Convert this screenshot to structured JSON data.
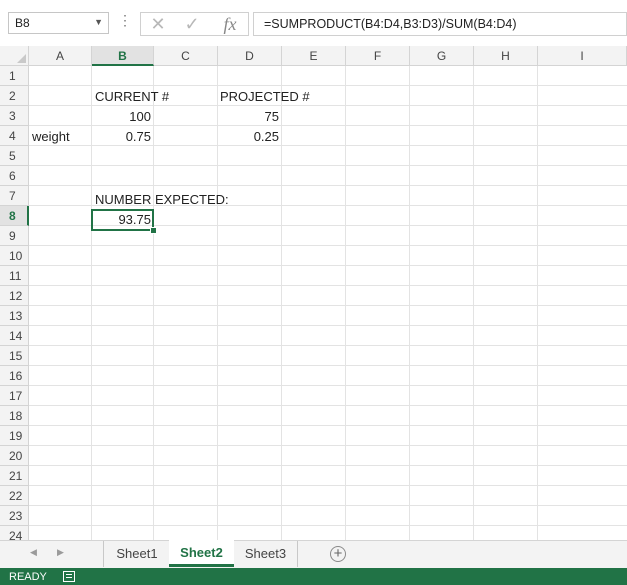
{
  "name_box": "B8",
  "formula": "=SUMPRODUCT(B4:D4,B3:D3)/SUM(B4:D4)",
  "columns": [
    "A",
    "B",
    "C",
    "D",
    "E",
    "F",
    "G",
    "H",
    "I"
  ],
  "rows": [
    "1",
    "2",
    "3",
    "4",
    "5",
    "6",
    "7",
    "8",
    "9",
    "10",
    "11",
    "12",
    "13",
    "14",
    "15",
    "16",
    "17",
    "18",
    "19",
    "20",
    "21",
    "22",
    "23",
    "24"
  ],
  "cells": {
    "B2": "CURRENT #",
    "D2": "PROJECTED #",
    "B3": "100",
    "D3": "75",
    "A4": "weight",
    "B4": "0.75",
    "D4": "0.25",
    "B7": "NUMBER EXPECTED:",
    "B8": "93.75"
  },
  "sheets": [
    "Sheet1",
    "Sheet2",
    "Sheet3"
  ],
  "active_sheet": "Sheet2",
  "status": "READY",
  "accent_color": "#217346"
}
